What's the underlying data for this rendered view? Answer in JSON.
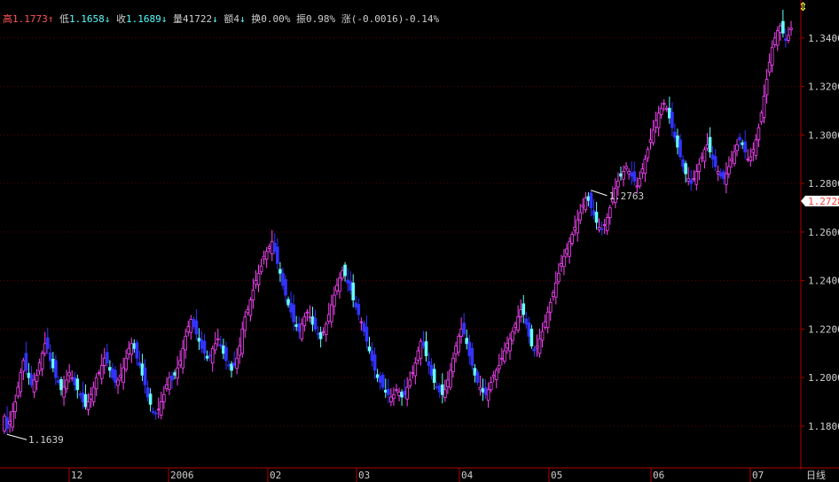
{
  "header": {
    "high_label": "高",
    "high_value": "1.1773",
    "high_arrow": "↑",
    "low_label": "低",
    "low_value": "1.1658",
    "low_arrow": "↓",
    "close_label": "收",
    "close_value": "1.1689",
    "close_arrow": "↓",
    "volume_label": "量",
    "volume_value": "41722",
    "volume_arrow": "↓",
    "amount_label": "额",
    "amount_value": "4",
    "amount_arrow": "↓",
    "turnover_label": "换",
    "turnover_value": "0.00%",
    "amplitude_label": "振",
    "amplitude_value": "0.98%",
    "change_label": "涨",
    "change_value": "(-0.0016)-0.14%"
  },
  "period_label": "日线",
  "colors": {
    "up": "#ff44ff",
    "down": "#3333ff",
    "down_light": "#66ffff",
    "axis": "#b00000",
    "grid": "#5a0000",
    "text": "#cfcfcf",
    "current": "#ff3b3b"
  },
  "chart_data": {
    "type": "candlestick",
    "ylim": [
      1.1639,
      1.3476
    ],
    "y_ticks": [
      "1.3400",
      "1.3200",
      "1.3000",
      "1.2800",
      "1.2600",
      "1.2400",
      "1.2200",
      "1.2000",
      "1.1800"
    ],
    "x_ticks": [
      "12",
      "2006",
      "02",
      "03",
      "04",
      "05",
      "06",
      "07"
    ],
    "current_price": "1.2728",
    "annotations": [
      {
        "label": "1.1639",
        "kind": "low"
      },
      {
        "label": "1.2763",
        "kind": "high"
      }
    ],
    "series_closes": [
      1.184,
      1.179,
      1.182,
      1.186,
      1.19,
      1.196,
      1.202,
      1.207,
      1.203,
      1.2,
      1.197,
      1.199,
      1.201,
      1.206,
      1.21,
      1.214,
      1.212,
      1.207,
      1.204,
      1.2,
      1.198,
      1.195,
      1.196,
      1.199,
      1.202,
      1.2,
      1.197,
      1.195,
      1.193,
      1.19,
      1.188,
      1.19,
      1.193,
      1.196,
      1.2,
      1.202,
      1.205,
      1.208,
      1.206,
      1.203,
      1.2,
      1.198,
      1.199,
      1.201,
      1.204,
      1.208,
      1.212,
      1.214,
      1.212,
      1.208,
      1.205,
      1.201,
      1.197,
      1.192,
      1.189,
      1.186,
      1.185,
      1.187,
      1.19,
      1.193,
      1.197,
      1.2,
      1.199,
      1.201,
      1.204,
      1.207,
      1.212,
      1.217,
      1.221,
      1.224,
      1.221,
      1.218,
      1.215,
      1.212,
      1.21,
      1.208,
      1.209,
      1.212,
      1.214,
      1.216,
      1.213,
      1.21,
      1.207,
      1.205,
      1.203,
      1.205,
      1.208,
      1.213,
      1.22,
      1.225,
      1.228,
      1.232,
      1.236,
      1.24,
      1.243,
      1.246,
      1.25,
      1.252,
      1.254,
      1.256,
      1.252,
      1.247,
      1.243,
      1.238,
      1.234,
      1.23,
      1.227,
      1.223,
      1.221,
      1.219,
      1.222,
      1.225,
      1.227,
      1.225,
      1.222,
      1.22,
      1.218,
      1.216,
      1.219,
      1.222,
      1.226,
      1.23,
      1.234,
      1.238,
      1.241,
      1.244,
      1.242,
      1.239,
      1.236,
      1.232,
      1.229,
      1.226,
      1.223,
      1.219,
      1.215,
      1.211,
      1.207,
      1.203,
      1.2,
      1.198,
      1.196,
      1.194,
      1.193,
      1.192,
      1.193,
      1.195,
      1.194,
      1.192,
      1.193,
      1.196,
      1.199,
      1.202,
      1.206,
      1.211,
      1.215,
      1.213,
      1.209,
      1.205,
      1.201,
      1.198,
      1.196,
      1.194,
      1.193,
      1.195,
      1.199,
      1.203,
      1.208,
      1.213,
      1.217,
      1.22,
      1.218,
      1.214,
      1.209,
      1.205,
      1.201,
      1.198,
      1.196,
      1.194,
      1.193,
      1.195,
      1.198,
      1.201,
      1.203,
      1.205,
      1.208,
      1.211,
      1.214,
      1.216,
      1.219,
      1.222,
      1.225,
      1.228,
      1.226,
      1.222,
      1.217,
      1.213,
      1.211,
      1.213,
      1.216,
      1.219,
      1.223,
      1.227,
      1.231,
      1.235,
      1.239,
      1.243,
      1.247,
      1.25,
      1.253,
      1.256,
      1.259,
      1.262,
      1.265,
      1.268,
      1.271,
      1.274,
      1.273,
      1.27,
      1.267,
      1.264,
      1.262,
      1.261,
      1.263,
      1.266,
      1.27,
      1.274,
      1.278,
      1.281,
      1.283,
      1.285,
      1.287,
      1.285,
      1.283,
      1.281,
      1.279,
      1.282,
      1.286,
      1.29,
      1.294,
      1.298,
      1.302,
      1.306,
      1.309,
      1.311,
      1.313,
      1.311,
      1.307,
      1.303,
      1.299,
      1.295,
      1.291,
      1.287,
      1.284,
      1.282,
      1.28,
      1.282,
      1.285,
      1.288,
      1.291,
      1.294,
      1.296,
      1.293,
      1.29,
      1.287,
      1.285,
      1.283,
      1.282,
      1.284,
      1.287,
      1.29,
      1.293,
      1.296,
      1.298,
      1.296,
      1.293,
      1.29,
      1.291,
      1.294,
      1.298,
      1.303,
      1.309,
      1.316,
      1.323,
      1.33,
      1.336,
      1.34,
      1.343,
      1.345,
      1.342,
      1.339,
      1.341,
      1.344
    ]
  }
}
